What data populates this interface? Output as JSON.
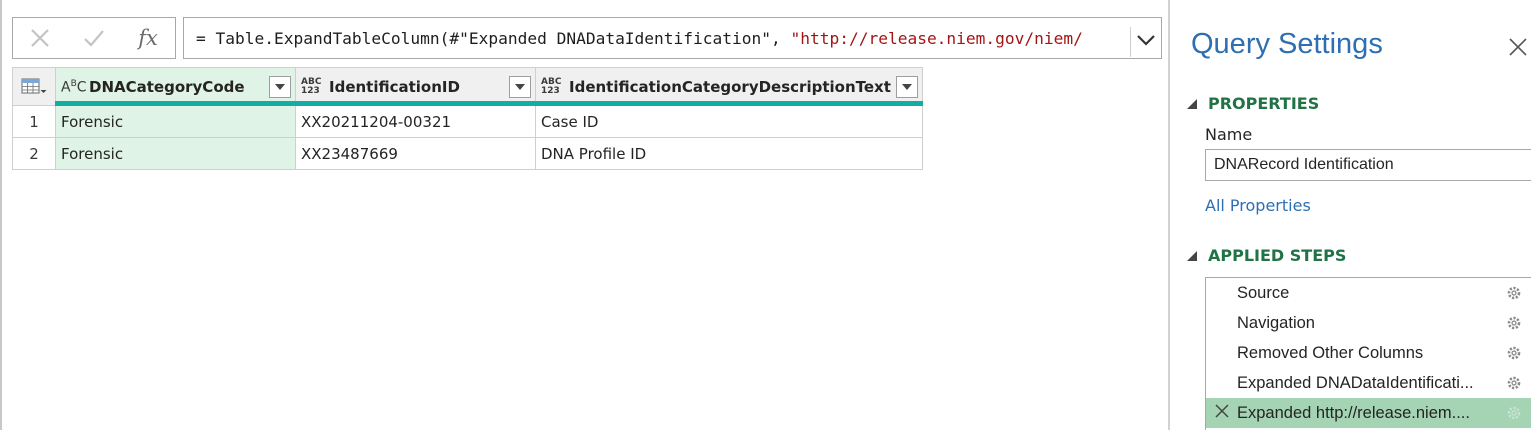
{
  "formula": {
    "code_part": "= Table.ExpandTableColumn(#\"Expanded DNADataIdentification\", ",
    "string_part": "\"http://release.niem.gov/niem/"
  },
  "grid": {
    "columns": [
      {
        "name": "DNACategoryCode",
        "type_icon": "ABC"
      },
      {
        "name": "IdentificationID",
        "type_icon": "ABC 123"
      },
      {
        "name": "IdentificationCategoryDescriptionText",
        "type_icon": "ABC 123"
      }
    ],
    "rows": [
      {
        "num": "1",
        "cells": [
          "Forensic",
          "XX20211204-00321",
          "Case ID"
        ]
      },
      {
        "num": "2",
        "cells": [
          "Forensic",
          "XX23487669",
          "DNA Profile ID"
        ]
      }
    ]
  },
  "query_settings": {
    "title": "Query Settings",
    "properties_heading": "PROPERTIES",
    "name_label": "Name",
    "name_value": "DNARecord Identification",
    "all_properties": "All Properties",
    "applied_steps_heading": "APPLIED STEPS",
    "steps": [
      {
        "label": "Source"
      },
      {
        "label": "Navigation"
      },
      {
        "label": "Removed Other Columns"
      },
      {
        "label": "Expanded DNADataIdentificati..."
      },
      {
        "label": "Expanded http://release.niem...."
      }
    ]
  },
  "colors": {
    "accent_blue": "#2e6fb3",
    "accent_green": "#217346",
    "quality_bar": "#13ada1",
    "selected_step": "#a4d4b4",
    "selected_column": "#dff3e6"
  },
  "icons": [
    "cancel-icon",
    "commit-icon",
    "fx-icon",
    "chevron-down-icon",
    "table-icon",
    "filter-dropdown-icon",
    "close-icon",
    "collapse-triangle-icon",
    "gear-icon",
    "delete-step-icon"
  ]
}
